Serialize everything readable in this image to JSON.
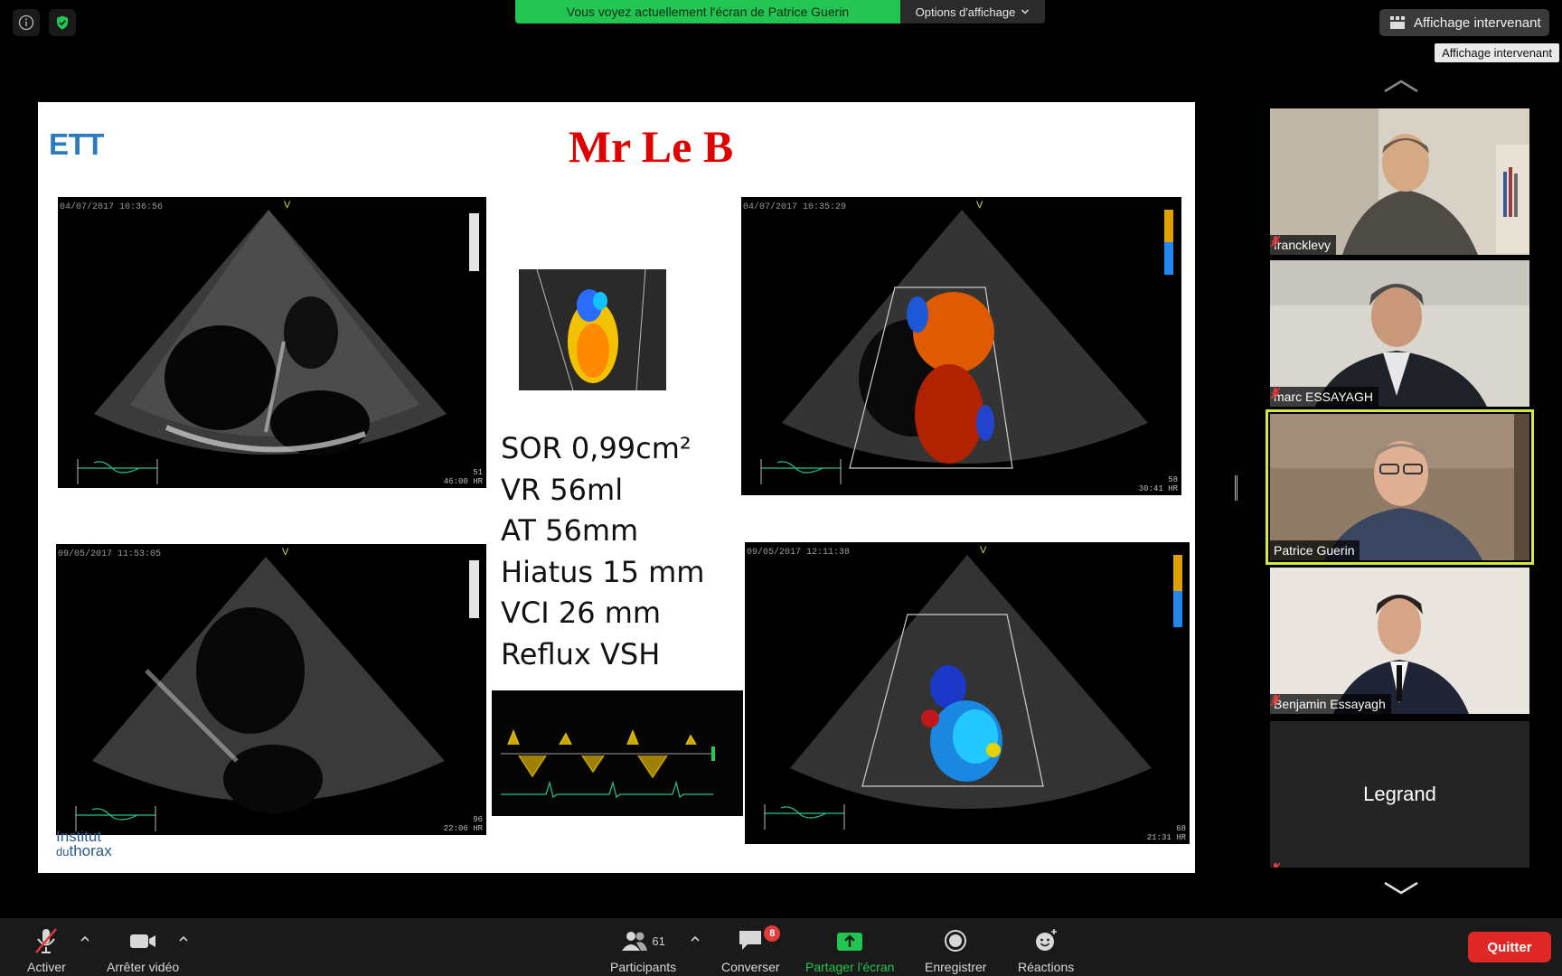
{
  "banner": {
    "sharing_text": "Vous voyez actuellement l'écran de Patrice Guerin",
    "options_label": "Options d'affichage"
  },
  "view_button": {
    "label": "Affichage intervenant",
    "tooltip": "Affichage intervenant"
  },
  "slide": {
    "ett": "ETT",
    "title": "Mr Le B",
    "lines": [
      "SOR 0,99cm²",
      "VR 56ml",
      "AT 56mm",
      "Hiatus 15 mm",
      "VCI 26 mm",
      "Reflux VSH"
    ],
    "footer_line1": "Institut",
    "footer_line2_small": "du",
    "footer_line2": "thorax",
    "echo_timestamps": [
      "04/07/2017 10:36:56",
      "04/07/2017 10:35:29",
      "09/05/2017 11:53:05",
      "09/05/2017 12:11:38"
    ],
    "echo_readouts": [
      "46:00",
      "30:41",
      "22:06",
      "21:31"
    ],
    "echo_hr": [
      "51",
      "58",
      "96",
      "68"
    ],
    "hr_unit": "HR"
  },
  "participants": [
    {
      "name": "francklevy",
      "muted": true
    },
    {
      "name": "marc ESSAYAGH",
      "muted": true
    },
    {
      "name": "Patrice Guerin",
      "muted": false,
      "speaking": true
    },
    {
      "name": "Benjamin Essayagh",
      "muted": true
    },
    {
      "name": "Legrand",
      "muted": true,
      "video": false
    }
  ],
  "toolbar": {
    "audio_label": "Activer",
    "video_label": "Arrêter vidéo",
    "participants_label": "Participants",
    "participants_count": "61",
    "chat_label": "Converser",
    "chat_badge": "8",
    "share_label": "Partager l'écran",
    "record_label": "Enregistrer",
    "reactions_label": "Réactions",
    "quit_label": "Quitter"
  },
  "colors": {
    "share_green": "#23c552",
    "active_speaker": "#d6e83c",
    "quit_red": "#e02828",
    "title_red": "#e00000"
  }
}
